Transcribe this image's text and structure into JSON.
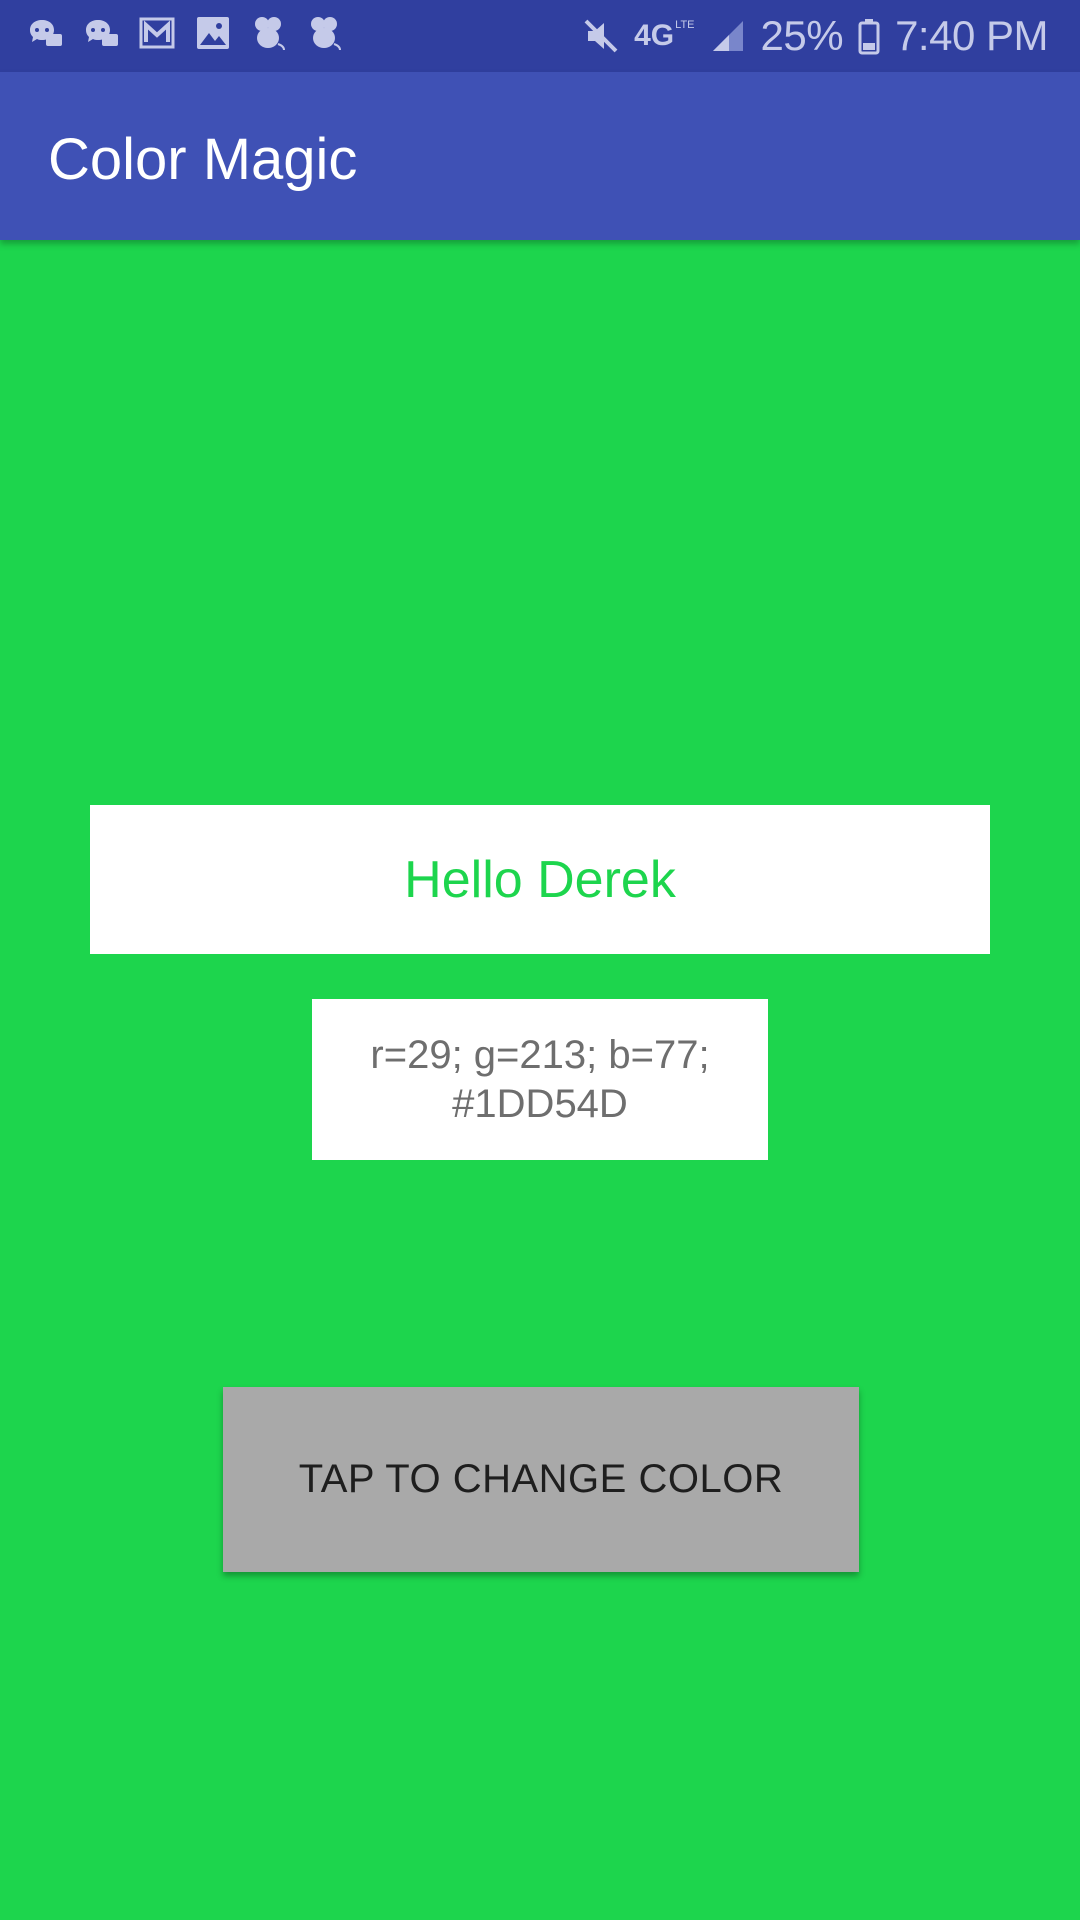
{
  "status_bar": {
    "notification_icons": [
      "chat-bubble-icon",
      "chat-bubble-icon",
      "gmail-icon",
      "image-icon",
      "mouse-icon",
      "mouse-icon"
    ],
    "mute_icon": "mute-icon",
    "network_type": "4G",
    "network_sub": "LTE",
    "battery_percent": "25%",
    "time": "7:40 PM"
  },
  "app_bar": {
    "title": "Color Magic"
  },
  "main": {
    "greeting": "Hello Derek",
    "color_info_line1": "r=29; g=213; b=77;",
    "color_info_line2": "#1DD54D",
    "button_label": "TAP TO CHANGE COLOR"
  },
  "colors": {
    "background": "#1DD54D",
    "status_bar": "#303F9F",
    "app_bar": "#3F51B5",
    "button": "#A9A9A9"
  }
}
